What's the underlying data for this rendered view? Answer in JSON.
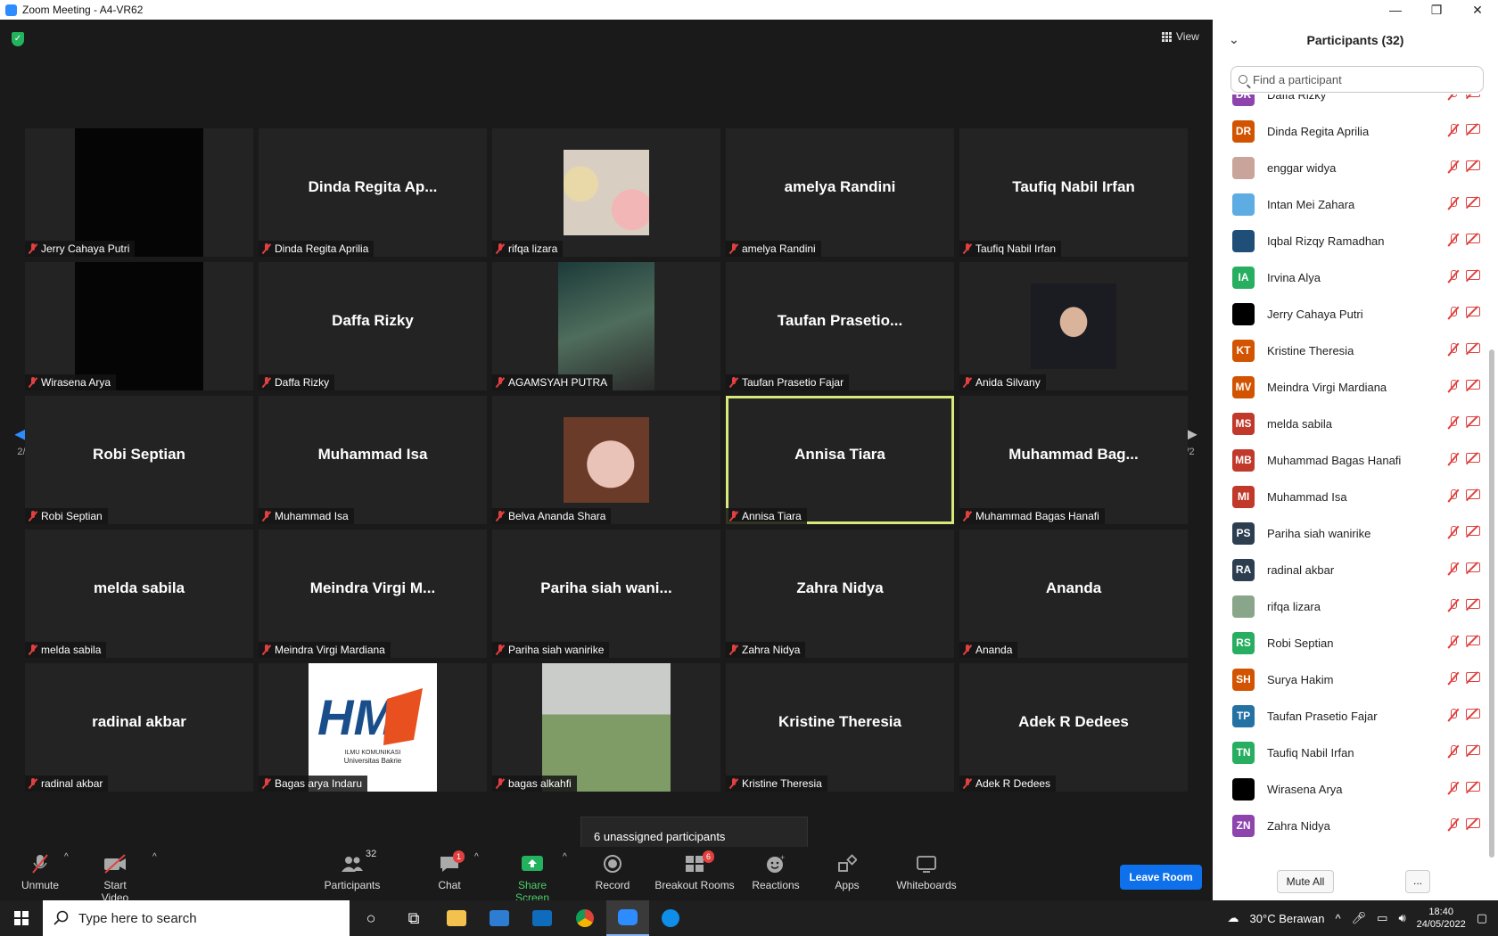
{
  "window": {
    "title": "Zoom Meeting - A4-VR62",
    "controls": [
      "—",
      "❐",
      "✕"
    ]
  },
  "meeting": {
    "view_label": "View",
    "page_left": "2/2",
    "page_right": "2/2",
    "tooltip": "6 unassigned participants",
    "tiles": [
      {
        "name": "Jerry Cahaya Putri",
        "big": "",
        "pic": "black"
      },
      {
        "name": "Dinda Regita Aprilia",
        "big": "Dinda Regita Ap...",
        "pic": ""
      },
      {
        "name": "rifqa lizara",
        "big": "",
        "pic": "photo-balloons"
      },
      {
        "name": "amelya Randini",
        "big": "amelya Randini",
        "pic": ""
      },
      {
        "name": "Taufiq Nabil Irfan",
        "big": "Taufiq Nabil Irfan",
        "pic": ""
      },
      {
        "name": "Wirasena Arya",
        "big": "",
        "pic": "black"
      },
      {
        "name": "Daffa Rizky",
        "big": "Daffa Rizky",
        "pic": ""
      },
      {
        "name": "AGAMSYAH PUTRA",
        "big": "",
        "pic": "photo-forest"
      },
      {
        "name": "Taufan Prasetio Fajar",
        "big": "Taufan Prasetio...",
        "pic": ""
      },
      {
        "name": "Anida Silvany",
        "big": "",
        "pic": "photo-hijab"
      },
      {
        "name": "Robi Septian",
        "big": "Robi Septian",
        "pic": ""
      },
      {
        "name": "Muhammad Isa",
        "big": "Muhammad Isa",
        "pic": ""
      },
      {
        "name": "Belva Ananda Shara",
        "big": "",
        "pic": "photo-flower"
      },
      {
        "name": "Annisa Tiara",
        "big": "Annisa Tiara",
        "pic": "",
        "active": true
      },
      {
        "name": "Muhammad Bagas Hanafi",
        "big": "Muhammad Bag...",
        "pic": ""
      },
      {
        "name": "melda sabila",
        "big": "melda sabila",
        "pic": ""
      },
      {
        "name": "Meindra Virgi Mardiana",
        "big": "Meindra Virgi M...",
        "pic": ""
      },
      {
        "name": "Pariha siah wanirike",
        "big": "Pariha siah wani...",
        "pic": ""
      },
      {
        "name": "Zahra Nidya",
        "big": "Zahra Nidya",
        "pic": ""
      },
      {
        "name": "Ananda",
        "big": "Ananda",
        "pic": ""
      },
      {
        "name": "radinal akbar",
        "big": "radinal akbar",
        "pic": ""
      },
      {
        "name": "Bagas arya Indaru",
        "big": "",
        "pic": "logo"
      },
      {
        "name": "bagas alkahfi",
        "big": "",
        "pic": "photo-field"
      },
      {
        "name": "Kristine Theresia",
        "big": "Kristine Theresia",
        "pic": ""
      },
      {
        "name": "Adek R Dedees",
        "big": "Adek R Dedees",
        "pic": ""
      }
    ],
    "logo_text": {
      "top": "ILMU KOMUNIKASI",
      "bottom": "Universitas Bakrie"
    }
  },
  "toolbar": {
    "unmute": "Unmute",
    "start_video": "Start Video",
    "participants": "Participants",
    "participants_count": "32",
    "chat": "Chat",
    "chat_badge": "1",
    "share_screen": "Share Screen",
    "record": "Record",
    "breakout_rooms": "Breakout Rooms",
    "breakout_badge": "6",
    "reactions": "Reactions",
    "apps": "Apps",
    "whiteboards": "Whiteboards",
    "leave_room": "Leave Room"
  },
  "panel": {
    "title": "Participants (32)",
    "search_placeholder": "Find a participant",
    "mute_all": "Mute All",
    "more": "...",
    "participants": [
      {
        "initials": "DR",
        "name": "Daffa Rizky",
        "color": "#8e44ad"
      },
      {
        "initials": "DR",
        "name": "Dinda Regita Aprilia",
        "color": "#d35400"
      },
      {
        "initials": "",
        "name": "enggar widya",
        "color": "#c9a49a"
      },
      {
        "initials": "",
        "name": "Intan Mei Zahara",
        "color": "#5dade2"
      },
      {
        "initials": "",
        "name": "Iqbal Rizqy Ramadhan",
        "color": "#1f4e79"
      },
      {
        "initials": "IA",
        "name": "Irvina Alya",
        "color": "#27ae60"
      },
      {
        "initials": "",
        "name": "Jerry Cahaya Putri",
        "color": "#000000"
      },
      {
        "initials": "KT",
        "name": "Kristine Theresia",
        "color": "#d35400"
      },
      {
        "initials": "MV",
        "name": "Meindra Virgi Mardiana",
        "color": "#d35400"
      },
      {
        "initials": "MS",
        "name": "melda sabila",
        "color": "#c0392b"
      },
      {
        "initials": "MB",
        "name": "Muhammad Bagas Hanafi",
        "color": "#c0392b"
      },
      {
        "initials": "MI",
        "name": "Muhammad Isa",
        "color": "#c0392b"
      },
      {
        "initials": "PS",
        "name": "Pariha siah wanirike",
        "color": "#2c3e50"
      },
      {
        "initials": "RA",
        "name": "radinal akbar",
        "color": "#2c3e50"
      },
      {
        "initials": "",
        "name": "rifqa lizara",
        "color": "#8aa68a"
      },
      {
        "initials": "RS",
        "name": "Robi Septian",
        "color": "#27ae60"
      },
      {
        "initials": "SH",
        "name": "Surya Hakim",
        "color": "#d35400"
      },
      {
        "initials": "TP",
        "name": "Taufan Prasetio Fajar",
        "color": "#2471a3"
      },
      {
        "initials": "TN",
        "name": "Taufiq Nabil Irfan",
        "color": "#27ae60"
      },
      {
        "initials": "",
        "name": "Wirasena Arya",
        "color": "#000000"
      },
      {
        "initials": "ZN",
        "name": "Zahra Nidya",
        "color": "#8e44ad"
      }
    ]
  },
  "taskbar": {
    "search_placeholder": "Type here to search",
    "weather": "30°C  Berawan",
    "time": "18:40",
    "date": "24/05/2022"
  }
}
